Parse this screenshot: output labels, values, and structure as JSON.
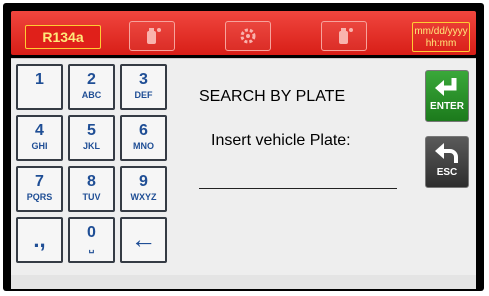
{
  "header": {
    "refrigerant": "R134a",
    "datetime_line1": "mm/dd/yyyy",
    "datetime_line2": "hh:mm",
    "icons": [
      "tank-icon",
      "gear-icon",
      "tank-icon"
    ],
    "bar_color": "#e0241c",
    "accent_color": "#ffcc33"
  },
  "keypad": {
    "keys": [
      {
        "digit": "1",
        "letters": ""
      },
      {
        "digit": "2",
        "letters": "ABC"
      },
      {
        "digit": "3",
        "letters": "DEF"
      },
      {
        "digit": "4",
        "letters": "GHI"
      },
      {
        "digit": "5",
        "letters": "JKL"
      },
      {
        "digit": "6",
        "letters": "MNO"
      },
      {
        "digit": "7",
        "letters": "PQRS"
      },
      {
        "digit": "8",
        "letters": "TUV"
      },
      {
        "digit": "9",
        "letters": "WXYZ"
      },
      {
        "digit": ".,",
        "letters": ""
      },
      {
        "digit": "0",
        "letters": "␣"
      },
      {
        "digit": "←",
        "letters": ""
      }
    ]
  },
  "main": {
    "title": "SEARCH BY PLATE",
    "prompt": "Insert vehicle Plate:",
    "plate_value": ""
  },
  "side_buttons": {
    "enter_label": "ENTER",
    "esc_label": "ESC"
  }
}
